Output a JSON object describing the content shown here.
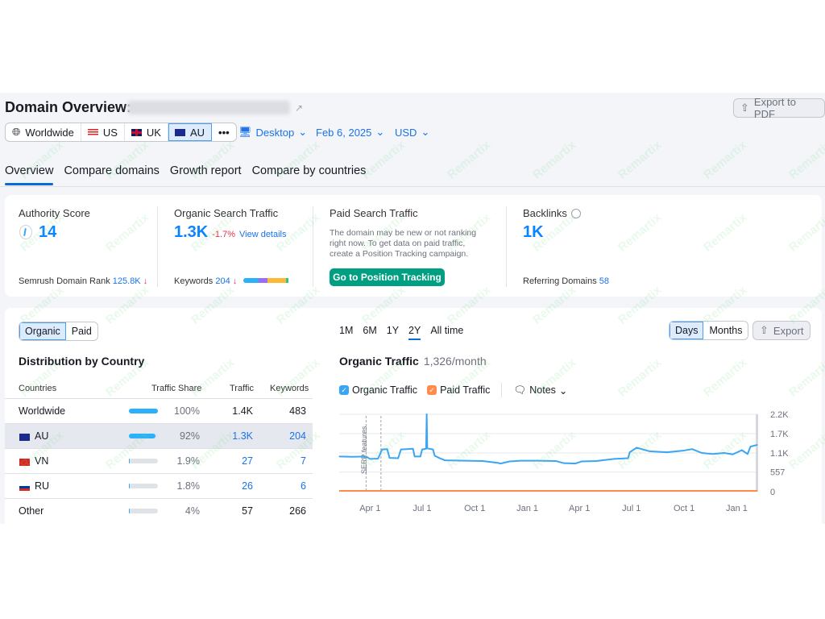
{
  "header": {
    "title": "Domain Overview:",
    "export_pdf": "Export to PDF"
  },
  "locations": [
    {
      "label": "Worldwide",
      "icon": "globe-icon"
    },
    {
      "label": "US",
      "icon": "us-flag-icon"
    },
    {
      "label": "UK",
      "icon": "uk-flag-icon"
    },
    {
      "label": "AU",
      "icon": "au-flag-icon",
      "selected": true
    },
    {
      "label": "•••",
      "icon": "more-icon"
    }
  ],
  "filters": {
    "device": "Desktop",
    "date": "Feb 6, 2025",
    "currency": "USD"
  },
  "tabs": [
    "Overview",
    "Compare domains",
    "Growth report",
    "Compare by countries"
  ],
  "metrics": {
    "authority": {
      "label": "Authority Score",
      "value": "14",
      "rank_label": "Semrush Domain Rank",
      "rank_value": "125.8K",
      "rank_arrow": "↓"
    },
    "organic": {
      "label": "Organic Search Traffic",
      "value": "1.3K",
      "change": "-1.7%",
      "link": "View details",
      "kw_label": "Keywords",
      "kw_value": "204",
      "kw_arrow": "↓"
    },
    "paid": {
      "label": "Paid Search Traffic",
      "desc": "The domain may be new or not ranking right now. To get data on paid traffic, create a Position Tracking campaign.",
      "button": "Go to Position Tracking"
    },
    "backlinks": {
      "label": "Backlinks",
      "value": "1K",
      "ref_label": "Referring Domains",
      "ref_value": "58"
    }
  },
  "distribution": {
    "toggle": [
      "Organic",
      "Paid"
    ],
    "title": "Distribution by Country",
    "columns": [
      "Countries",
      "Traffic Share",
      "Traffic",
      "Keywords"
    ],
    "rows": [
      {
        "country": "Worldwide",
        "share": "100%",
        "share_pct": 100,
        "traffic": "1.4K",
        "keywords": "483"
      },
      {
        "country": "AU",
        "share": "92%",
        "share_pct": 92,
        "traffic": "1.3K",
        "keywords": "204",
        "highlight": true
      },
      {
        "country": "VN",
        "share": "1.9%",
        "share_pct": 1.9,
        "traffic": "27",
        "keywords": "7"
      },
      {
        "country": "RU",
        "share": "1.8%",
        "share_pct": 1.8,
        "traffic": "26",
        "keywords": "6"
      },
      {
        "country": "Other",
        "share": "4%",
        "share_pct": 4,
        "traffic": "57",
        "keywords": "266"
      }
    ]
  },
  "traffic": {
    "periods": [
      "1M",
      "6M",
      "1Y",
      "2Y",
      "All time"
    ],
    "selected_period": "2Y",
    "granularity": [
      "Days",
      "Months"
    ],
    "export": "Export",
    "title": "Organic Traffic",
    "subtitle": "1,326/month",
    "legend": [
      "Organic Traffic",
      "Paid Traffic"
    ],
    "notes": "Notes",
    "annotation": "SERP features"
  },
  "chart_data": {
    "type": "line",
    "xlim": [
      "2023-02-06",
      "2025-02-06"
    ],
    "ylim": [
      0,
      2200
    ],
    "yticks": [
      "0",
      "557",
      "1.1K",
      "1.7K",
      "2.2K"
    ],
    "ytick_values": [
      0,
      557,
      1100,
      1650,
      2200
    ],
    "xticks": [
      "Apr 1",
      "Jul 1",
      "Oct 1",
      "Jan 1",
      "Apr 1",
      "Jul 1",
      "Oct 1",
      "Jan 1"
    ],
    "xtick_dates": [
      "2023-04-01",
      "2023-07-01",
      "2023-10-01",
      "2024-01-01",
      "2024-04-01",
      "2024-07-01",
      "2024-10-01",
      "2025-01-01"
    ],
    "annotation_dates": [
      "2023-03-25",
      "2023-04-20"
    ],
    "grid": true,
    "colors": {
      "organic": "#3aa5f4",
      "paid": "#ff8c4a"
    },
    "series": [
      {
        "name": "Organic Traffic",
        "points": [
          [
            "2023-02-06",
            1000
          ],
          [
            "2023-03-01",
            990
          ],
          [
            "2023-03-25",
            1000
          ],
          [
            "2023-04-01",
            930
          ],
          [
            "2023-04-15",
            940
          ],
          [
            "2023-04-22",
            1200
          ],
          [
            "2023-05-01",
            1210
          ],
          [
            "2023-05-05",
            960
          ],
          [
            "2023-05-20",
            950
          ],
          [
            "2023-05-25",
            1200
          ],
          [
            "2023-06-15",
            1220
          ],
          [
            "2023-06-18",
            1000
          ],
          [
            "2023-06-28",
            1000
          ],
          [
            "2023-07-01",
            1200
          ],
          [
            "2023-07-08",
            1220
          ],
          [
            "2023-07-09",
            2200
          ],
          [
            "2023-07-10",
            1230
          ],
          [
            "2023-07-20",
            1200
          ],
          [
            "2023-07-23",
            1020
          ],
          [
            "2023-08-01",
            950
          ],
          [
            "2023-08-10",
            890
          ],
          [
            "2023-09-15",
            880
          ],
          [
            "2023-10-15",
            870
          ],
          [
            "2023-11-10",
            820
          ],
          [
            "2023-11-15",
            800
          ],
          [
            "2023-12-01",
            860
          ],
          [
            "2023-12-20",
            880
          ],
          [
            "2024-01-20",
            880
          ],
          [
            "2024-02-20",
            870
          ],
          [
            "2024-03-05",
            810
          ],
          [
            "2024-03-25",
            800
          ],
          [
            "2024-04-05",
            860
          ],
          [
            "2024-05-01",
            870
          ],
          [
            "2024-05-15",
            900
          ],
          [
            "2024-06-01",
            930
          ],
          [
            "2024-06-25",
            950
          ],
          [
            "2024-06-28",
            1120
          ],
          [
            "2024-07-10",
            1250
          ],
          [
            "2024-08-01",
            1150
          ],
          [
            "2024-09-01",
            1120
          ],
          [
            "2024-10-01",
            1170
          ],
          [
            "2024-10-15",
            1210
          ],
          [
            "2024-11-01",
            1100
          ],
          [
            "2024-11-20",
            1070
          ],
          [
            "2024-12-10",
            1100
          ],
          [
            "2024-12-25",
            1060
          ],
          [
            "2025-01-10",
            1180
          ],
          [
            "2025-01-20",
            1070
          ],
          [
            "2025-01-25",
            1280
          ],
          [
            "2025-02-06",
            1330
          ]
        ]
      },
      {
        "name": "Paid Traffic",
        "points": [
          [
            "2023-02-06",
            0
          ],
          [
            "2025-02-06",
            0
          ]
        ]
      }
    ]
  },
  "watermark": "Remartix"
}
